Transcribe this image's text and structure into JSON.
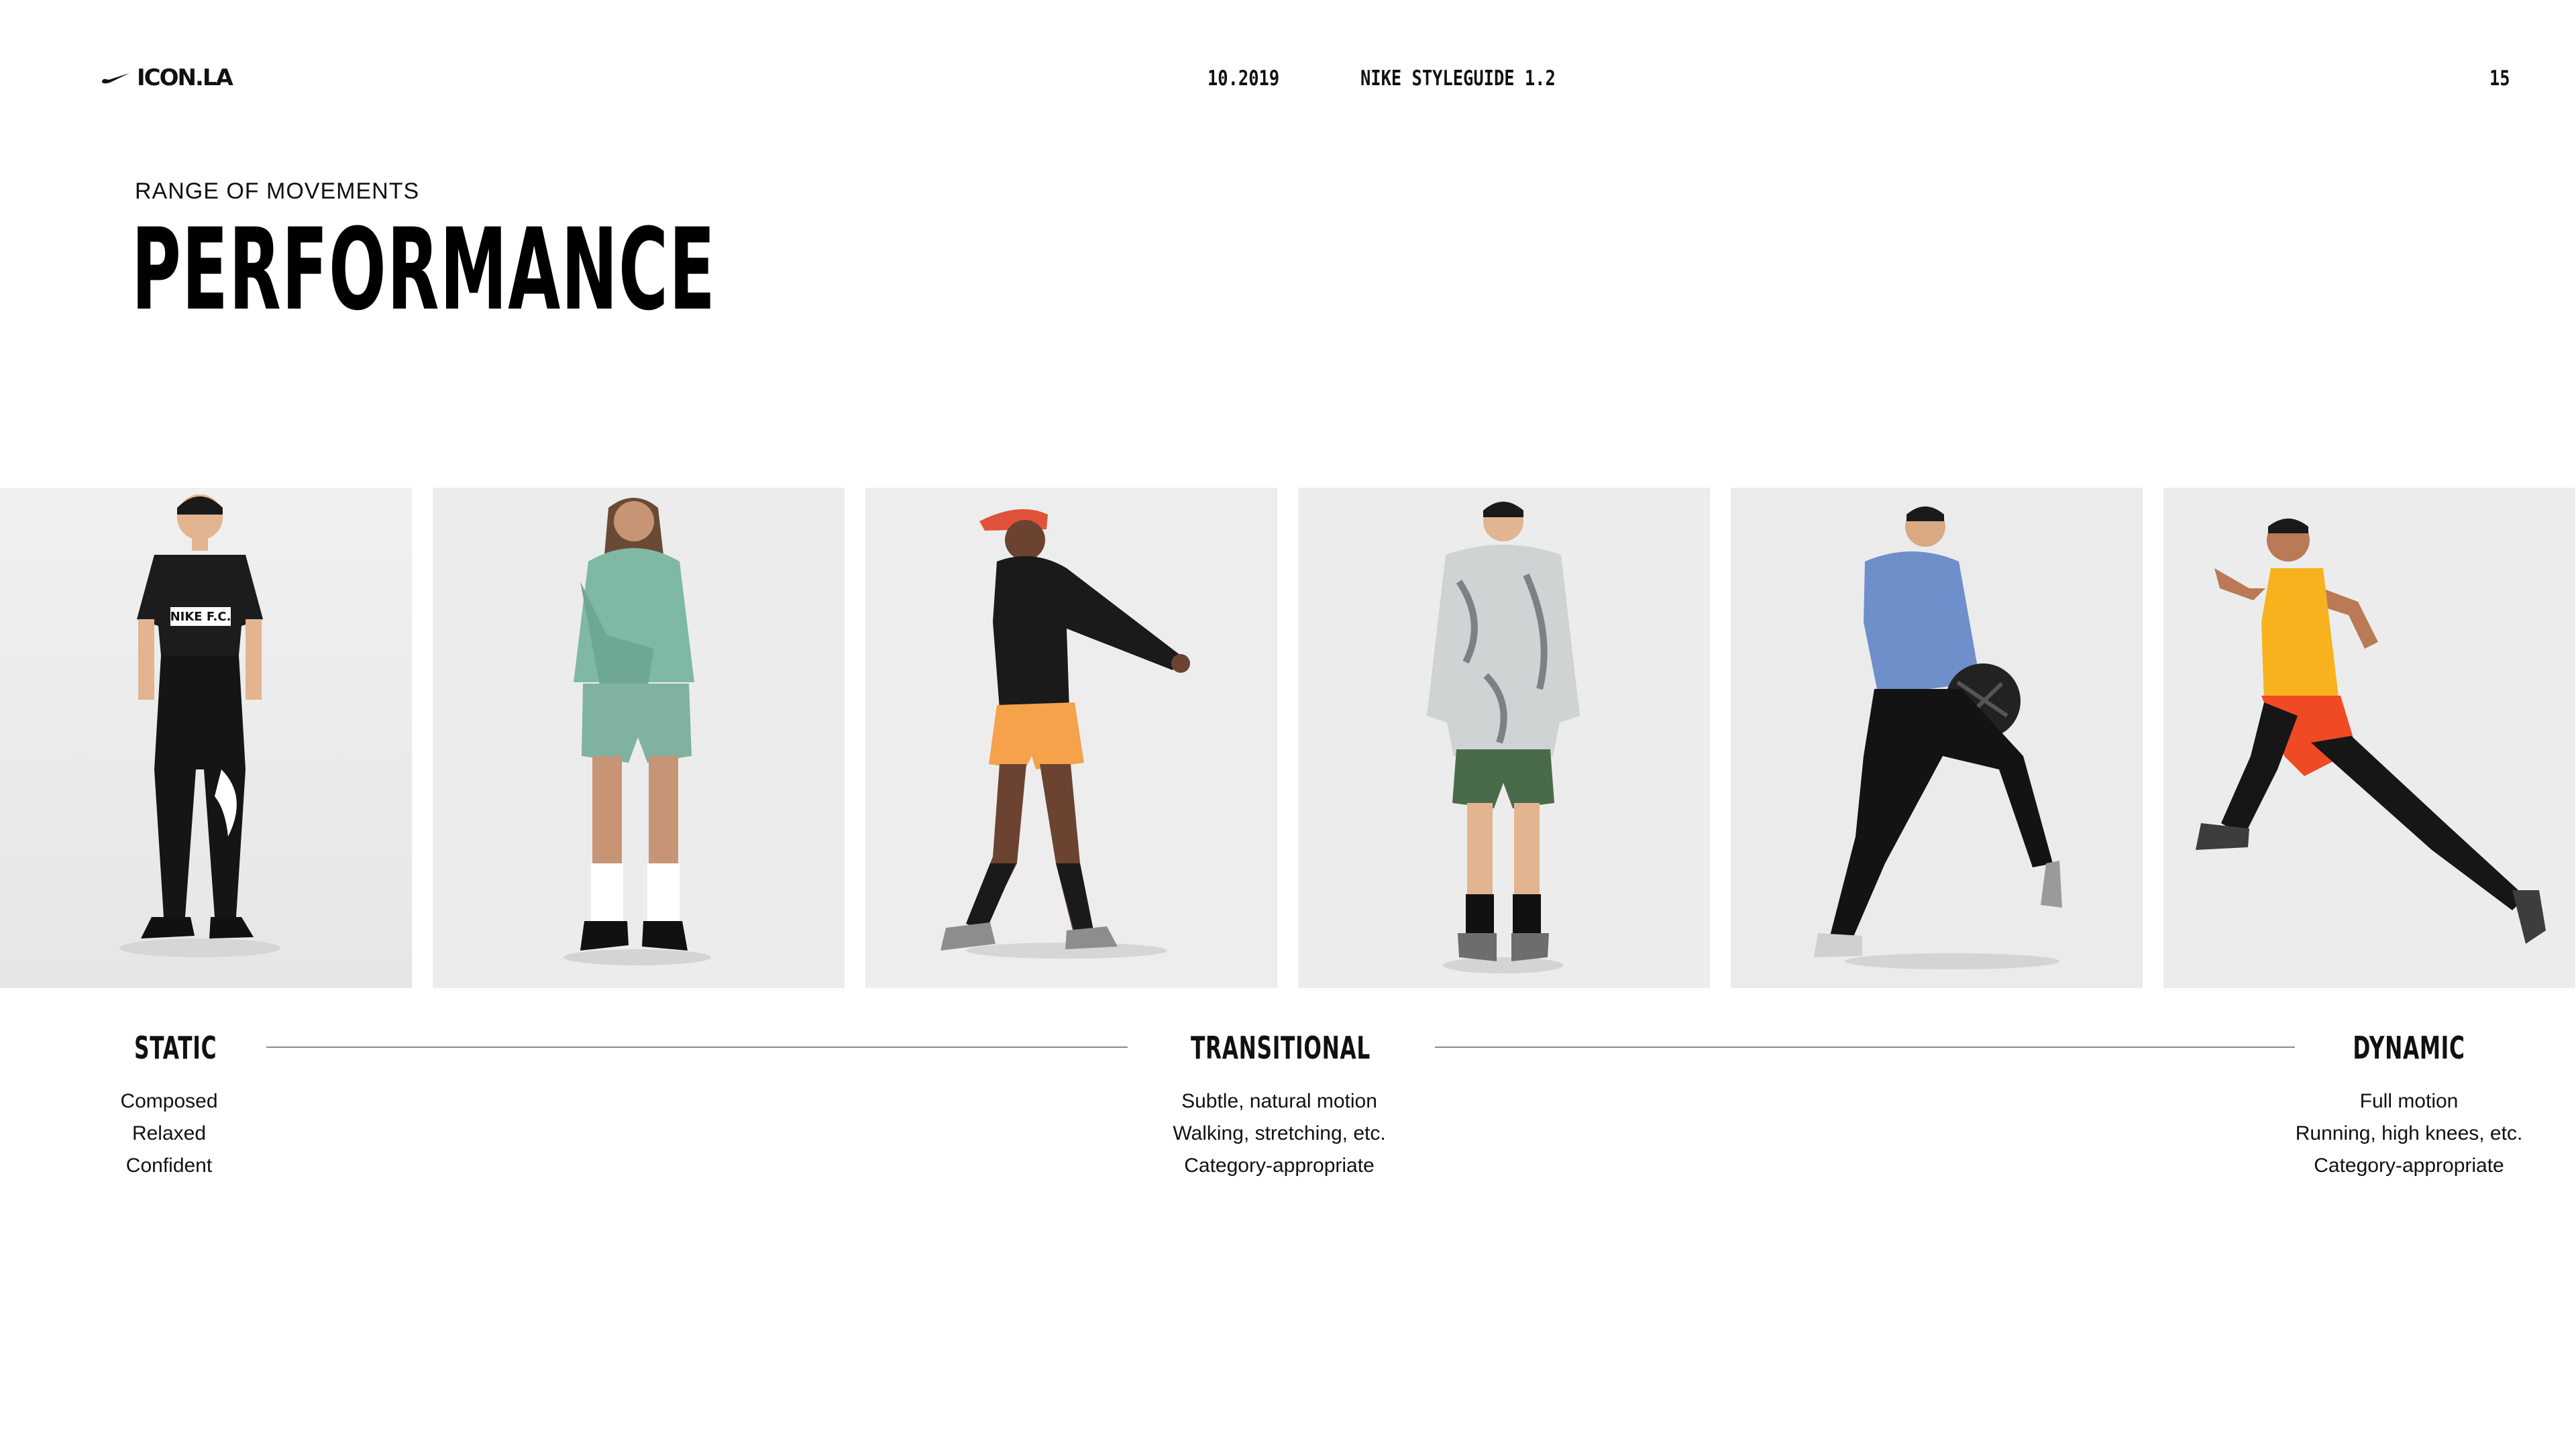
{
  "header": {
    "logo_text": "ICON.LA",
    "logo_icon": "swoosh-icon",
    "date": "10.2019",
    "doc_title": "NIKE STYLEGUIDE 1.2",
    "page_number": "15"
  },
  "section": {
    "eyebrow": "RANGE OF MOVEMENTS",
    "title": "PERFORMANCE"
  },
  "photos": [
    {
      "name": "photo-static-tee",
      "shirt_text": "NIKE F.C.",
      "colors": {
        "top": "#1c1c1c",
        "bottom": "#151515",
        "skin": "#e2b48f"
      }
    },
    {
      "name": "photo-hoodie-shorts",
      "colors": {
        "top": "#7fb8a4",
        "bottom": "#7fb3a0",
        "skin": "#c89476"
      }
    },
    {
      "name": "photo-walking-orange-shorts",
      "colors": {
        "top": "#1a1a1a",
        "bottom": "#f5a24b",
        "skin": "#6b4330",
        "cap": "#e0533a"
      }
    },
    {
      "name": "photo-marble-jacket",
      "colors": {
        "top": "#cfd3d4",
        "bottom": "#496b4c",
        "skin": "#e2b48f"
      }
    },
    {
      "name": "photo-medicine-ball-lunge",
      "colors": {
        "top": "#6f8fcb",
        "bottom": "#131313",
        "skin": "#d9a984"
      }
    },
    {
      "name": "photo-sprinting-tank",
      "colors": {
        "top": "#f7b21e",
        "bottom": "#161616",
        "skin": "#b97a55",
        "shorts": "#f04a24"
      }
    }
  ],
  "scale": {
    "static": {
      "label": "STATIC",
      "lines": [
        "Composed",
        "Relaxed",
        "Confident"
      ]
    },
    "transitional": {
      "label": "TRANSITIONAL",
      "lines": [
        "Subtle, natural motion",
        "Walking, stretching, etc.",
        "Category-appropriate"
      ]
    },
    "dynamic": {
      "label": "DYNAMIC",
      "lines": [
        "Full motion",
        "Running, high knees, etc.",
        "Category-appropriate"
      ]
    }
  }
}
